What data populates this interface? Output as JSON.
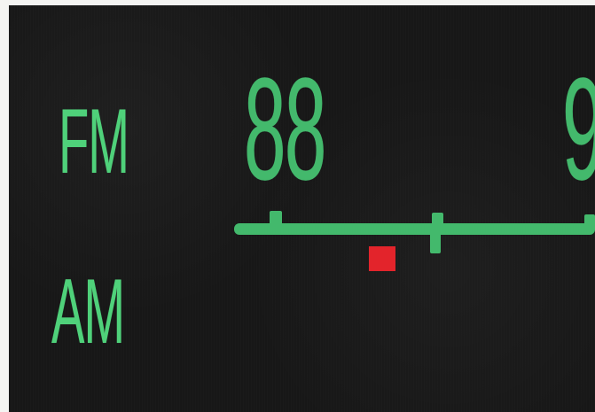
{
  "dial": {
    "band_fm": "FM",
    "band_am": "AM",
    "freq_88": "88",
    "freq_next_partial": "9",
    "indicator_color": "#e3242b",
    "scale_color": "#43b96c",
    "label_color": "#4fd17a",
    "background_color": "#171717"
  }
}
